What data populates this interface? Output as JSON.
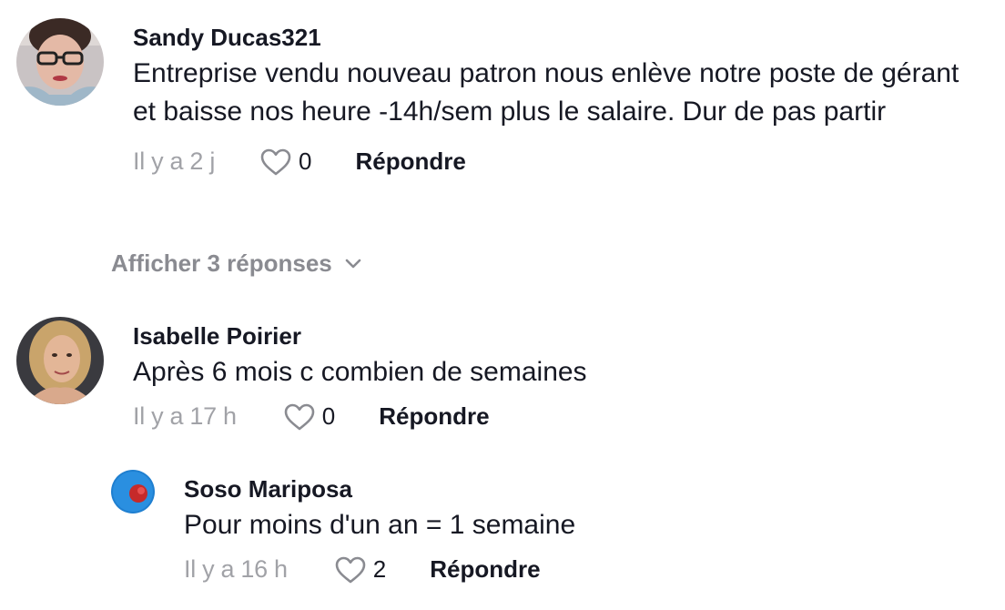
{
  "comments": [
    {
      "username": "Sandy Ducas321",
      "text": "Entreprise vendu nouveau patron nous enlève notre poste de gérant et baisse nos heure -14h/sem plus le salaire. Dur de pas partir",
      "time": "Il y a 2 j",
      "likes": "0",
      "reply_label": "Répondre",
      "show_replies_label": "Afficher 3 réponses"
    },
    {
      "username": "Isabelle Poirier",
      "text": "Après 6 mois c combien de semaines",
      "time": "Il y a 17 h",
      "likes": "0",
      "reply_label": "Répondre",
      "replies": [
        {
          "username": "Soso Mariposa",
          "text": "Pour moins d'un an = 1 semaine",
          "time": "Il y a 16 h",
          "likes": "2",
          "reply_label": "Répondre"
        }
      ]
    }
  ],
  "icons": {
    "like": "heart-outline-icon",
    "expand": "chevron-down-icon"
  },
  "colors": {
    "text_primary": "#161823",
    "text_secondary": "#8a8b91",
    "background": "#ffffff"
  }
}
